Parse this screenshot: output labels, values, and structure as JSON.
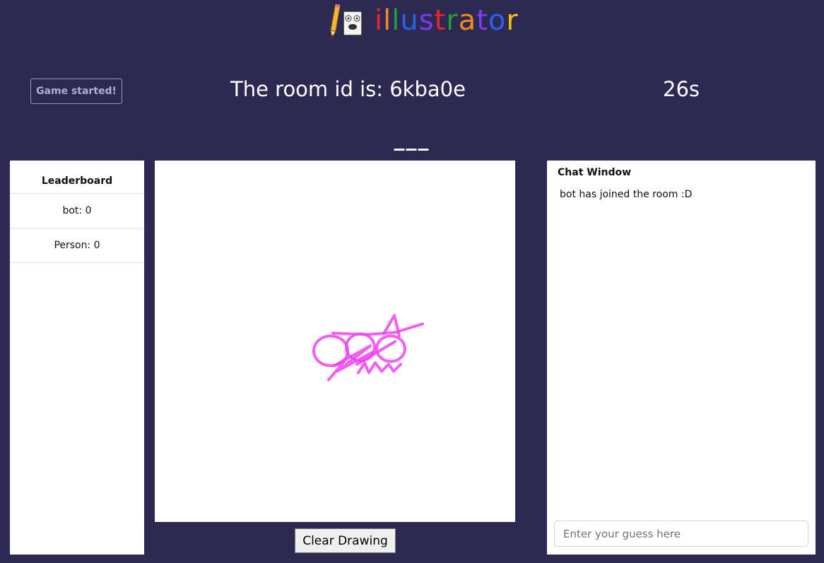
{
  "header": {
    "logo_text": "illustrator",
    "logo_colors": [
      "#e8262a",
      "#f08a1c",
      "#1f9e3b",
      "#2563eb",
      "#7c3aed",
      "#e8262a",
      "#1f9e3b",
      "#f08a1c",
      "#7c3aed",
      "#2563eb",
      "#f2c200"
    ],
    "game_status_label": "Game started!",
    "room_id_text": "The room id is: 6kba0e",
    "timer_text": "26s",
    "word_hint": "___"
  },
  "leaderboard": {
    "title": "Leaderboard",
    "items": [
      {
        "label": "bot: 0"
      },
      {
        "label": "Person: 0"
      }
    ]
  },
  "canvas": {
    "stroke_color": "#ee44ee",
    "clear_button_label": "Clear Drawing"
  },
  "chat": {
    "title": "Chat Window",
    "messages": [
      {
        "text": "bot has joined the room :D"
      }
    ],
    "input_placeholder": "Enter your guess here"
  }
}
